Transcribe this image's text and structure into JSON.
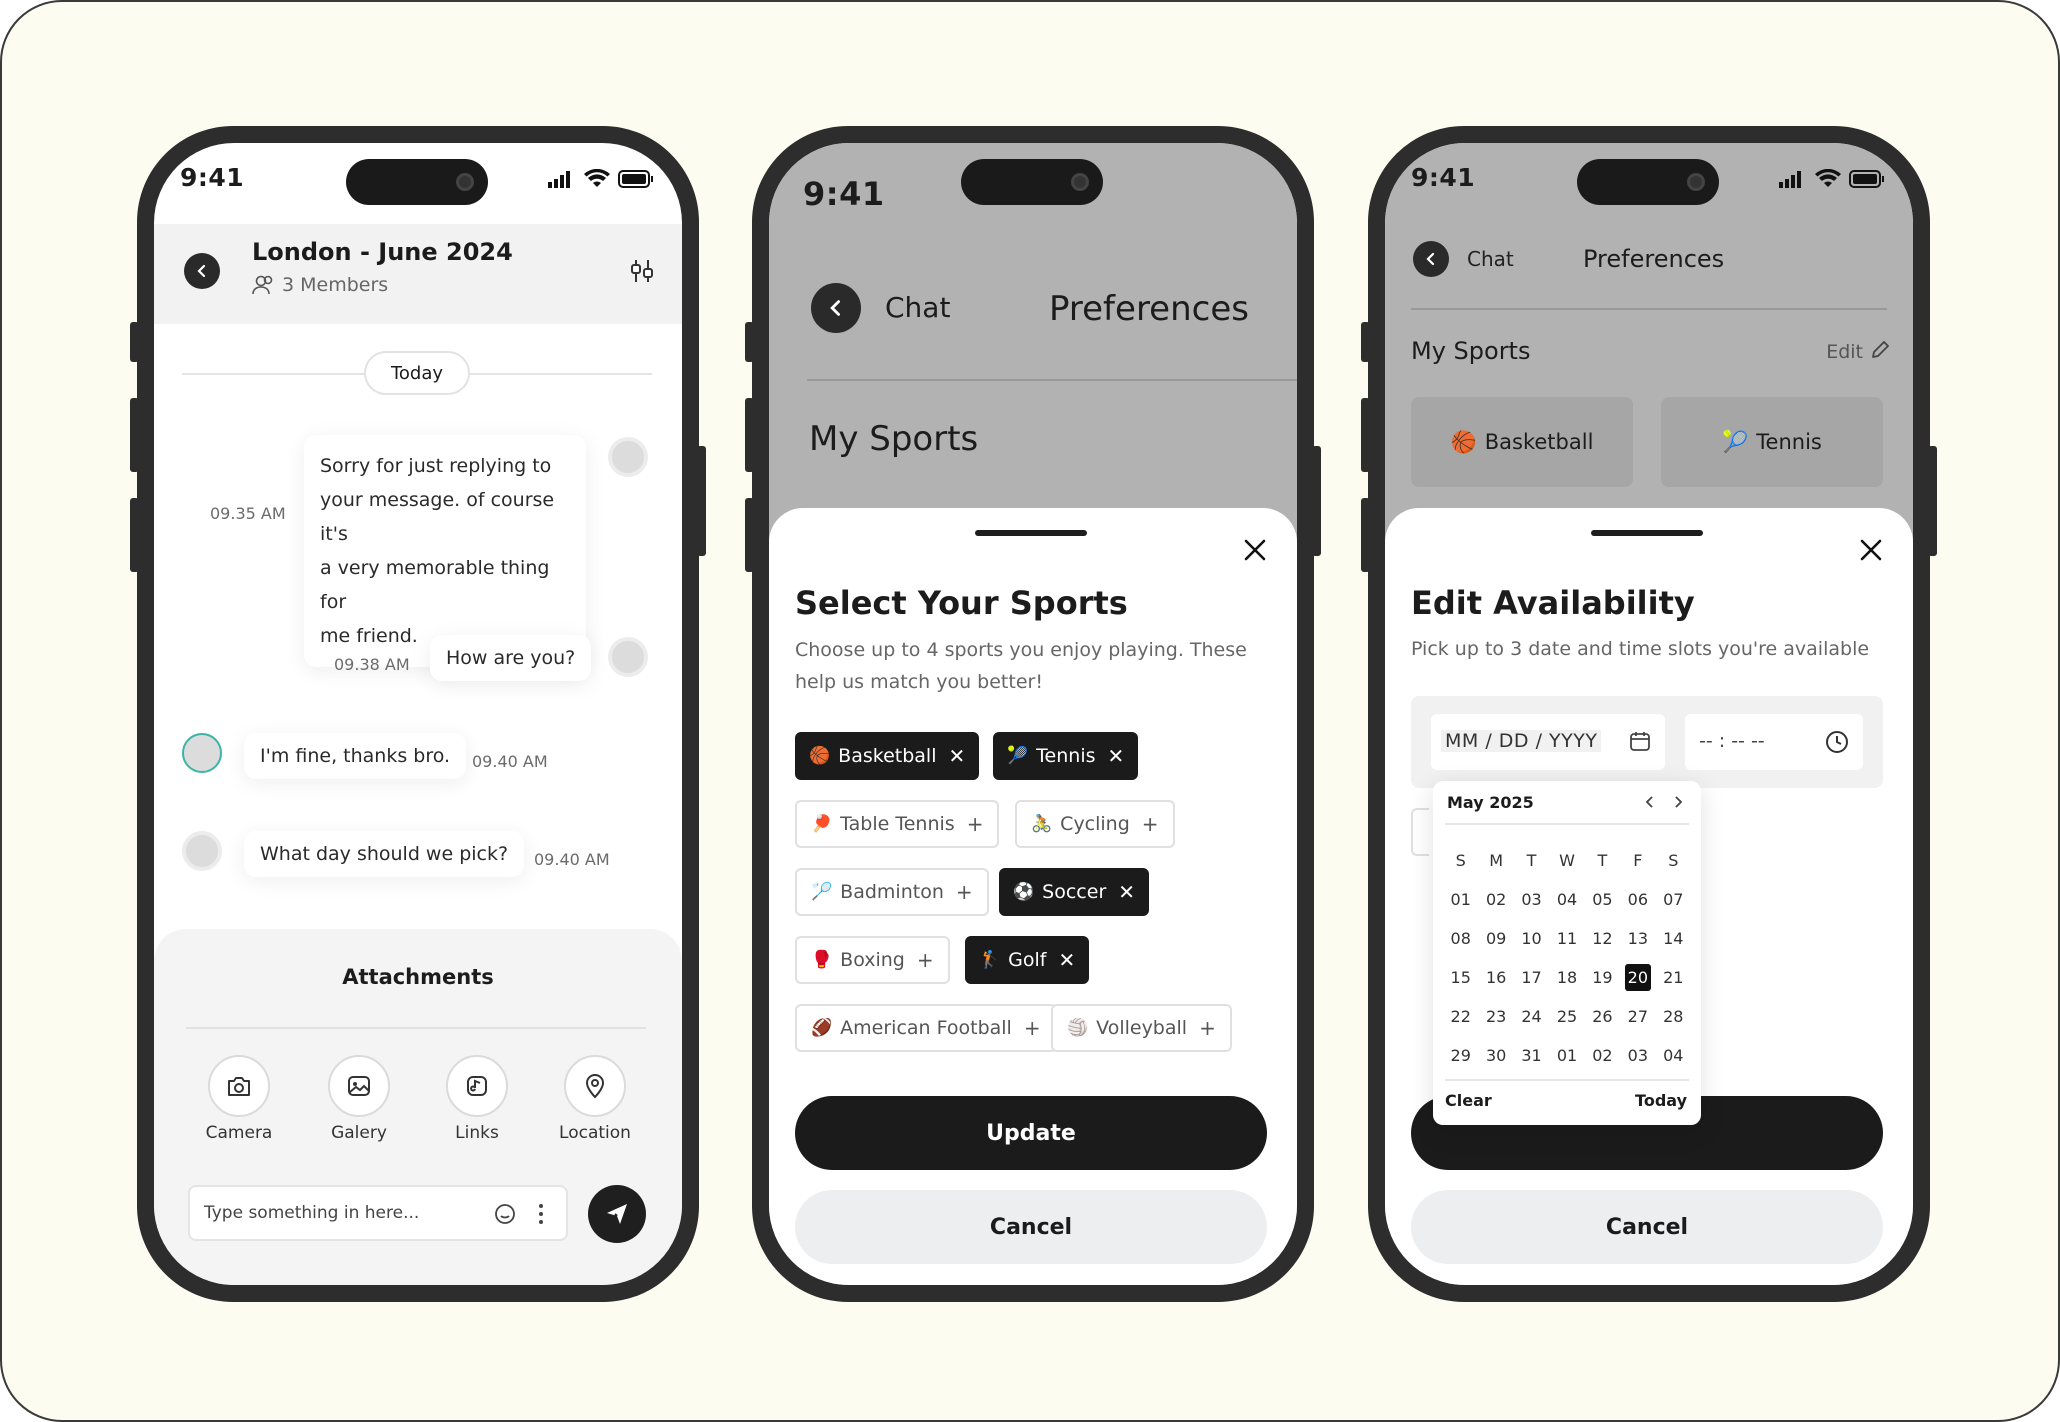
{
  "status": {
    "time": "9:41"
  },
  "chat": {
    "title": "London - June 2024",
    "members": "3 Members",
    "date_divider": "Today",
    "messages": [
      {
        "text": "Sorry for just replying to your message. of course it's a very memorable thing for me friend.",
        "lines": [
          "Sorry for just replying to",
          "your message. of course it's",
          "a very memorable thing for",
          "me friend."
        ],
        "time": "09.35 AM",
        "side": "right"
      },
      {
        "text": "How are you?",
        "time": "09.38 AM",
        "side": "right"
      },
      {
        "text": "I'm fine, thanks bro.",
        "time": "09.40 AM",
        "side": "left"
      },
      {
        "text": "What day should we pick?",
        "time": "09.40 AM",
        "side": "left"
      }
    ],
    "attachments": {
      "title": "Attachments",
      "items": [
        {
          "label": "Camera",
          "icon": "camera-icon"
        },
        {
          "label": "Galery",
          "icon": "gallery-icon"
        },
        {
          "label": "Links",
          "icon": "link-icon"
        },
        {
          "label": "Location",
          "icon": "location-icon"
        }
      ]
    },
    "input": {
      "placeholder": "Type something in here..."
    }
  },
  "prefs": {
    "back_label": "Chat",
    "title": "Preferences",
    "my_sports": "My Sports",
    "edit": "Edit",
    "sports_shown": [
      {
        "label": "Basketball",
        "emoji": "🏀"
      },
      {
        "label": "Tennis",
        "emoji": "🎾"
      }
    ]
  },
  "select_sports": {
    "title": "Select Your Sports",
    "description_lines": [
      "Choose up to 4 sports you enjoy playing. These",
      "help us match you better!"
    ],
    "sports": [
      {
        "label": "Basketball",
        "emoji": "🏀",
        "selected": true
      },
      {
        "label": "Tennis",
        "emoji": "🎾",
        "selected": true
      },
      {
        "label": "Table Tennis",
        "emoji": "🏓",
        "selected": false
      },
      {
        "label": "Cycling",
        "emoji": "🚴",
        "selected": false
      },
      {
        "label": "Badminton",
        "emoji": "🏸",
        "selected": false
      },
      {
        "label": "Soccer",
        "emoji": "⚽",
        "selected": true
      },
      {
        "label": "Boxing",
        "emoji": "🥊",
        "selected": false
      },
      {
        "label": "Golf",
        "emoji": "🏌",
        "selected": true
      },
      {
        "label": "American Football",
        "emoji": "🏈",
        "selected": false
      },
      {
        "label": "Volleyball",
        "emoji": "🏐",
        "selected": false
      }
    ],
    "update": "Update",
    "cancel": "Cancel"
  },
  "availability": {
    "title": "Edit Availability",
    "description": "Pick up to 3 date and time slots you're available",
    "date_placeholder": "MM / DD / YYYY",
    "time_placeholder": "-- : -- --",
    "cancel": "Cancel",
    "calendar": {
      "month": "May 2025",
      "weekdays": [
        "S",
        "M",
        "T",
        "W",
        "T",
        "F",
        "S"
      ],
      "days": [
        "01",
        "02",
        "03",
        "04",
        "05",
        "06",
        "07",
        "08",
        "09",
        "10",
        "11",
        "12",
        "13",
        "14",
        "15",
        "16",
        "17",
        "18",
        "19",
        "20",
        "21",
        "22",
        "23",
        "24",
        "25",
        "26",
        "27",
        "28",
        "29",
        "30",
        "31",
        "01",
        "02",
        "03",
        "04"
      ],
      "selected": "20",
      "clear": "Clear",
      "today": "Today"
    }
  },
  "colors": {
    "background": "#fdfcf0",
    "phone": "#2d2d2d",
    "dark_button": "#1b1b1b",
    "overlay": "#b2b2b2",
    "accent_avatar_ring": "#3ab5a8"
  }
}
